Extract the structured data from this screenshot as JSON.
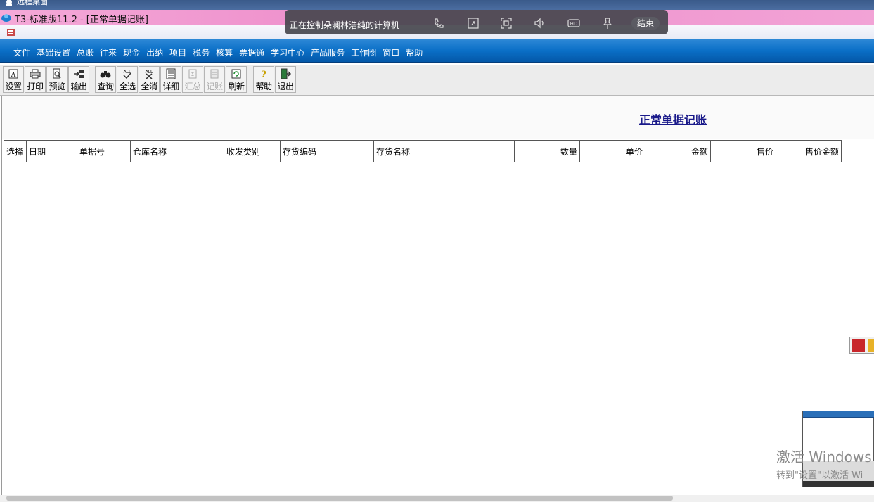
{
  "remote": {
    "strip_label": "远程桌面",
    "control_text": "正在控制朵澜林浩纯的计算机",
    "end_button": "结束",
    "icons": [
      "phone-icon",
      "fullscreen-icon",
      "capture-icon",
      "volume-icon",
      "hd-icon",
      "pin-icon"
    ]
  },
  "window": {
    "title": "T3-标准版11.2 - [正常单据记账]"
  },
  "menu": [
    "文件",
    "基础设置",
    "总账",
    "往来",
    "现金",
    "出纳",
    "项目",
    "税务",
    "核算",
    "票据通",
    "学习中心",
    "产品服务",
    "工作圈",
    "窗口",
    "帮助"
  ],
  "toolbar": {
    "settings": "设置",
    "print": "打印",
    "preview": "预览",
    "export": "输出",
    "query": "查询",
    "select_all": "全选",
    "deselect_all": "全消",
    "detail": "详细",
    "summary": "汇总",
    "post": "记账",
    "refresh": "刷新",
    "help": "帮助",
    "exit": "退出"
  },
  "page": {
    "title": "正常单据记账"
  },
  "table": {
    "columns": [
      "选择",
      "日期",
      "单据号",
      "仓库名称",
      "收发类别",
      "存货编码",
      "存货名称",
      "数量",
      "单价",
      "金额",
      "售价",
      "售价金额"
    ]
  },
  "watermark": {
    "line1": "激活 Windows",
    "line2": "转到\"设置\"以激活 Wi"
  },
  "colors": {
    "menubar": "#0a6fc7",
    "titlebar": "#ee8ecb",
    "page_title": "#1a1a8a"
  }
}
